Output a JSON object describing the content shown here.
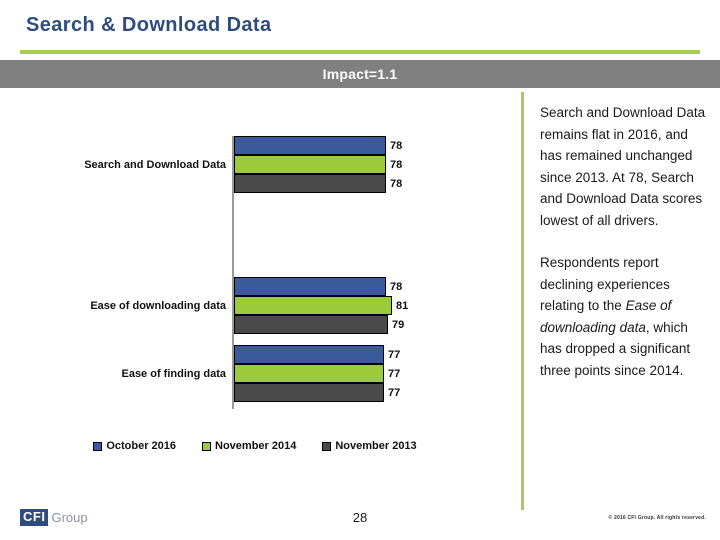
{
  "header": {
    "title": "Search & Download Data",
    "rule_color": "#A6CE53",
    "title_color": "#2E4C7E"
  },
  "impact_band": {
    "label": "Impact=1.1",
    "background": "#808080",
    "text_color": "#FFFFFF"
  },
  "chart_data": {
    "type": "bar",
    "orientation": "horizontal",
    "title": "",
    "xlabel": "",
    "ylabel": "",
    "categories": [
      "Search and Download Data",
      "Ease of downloading data",
      "Ease of finding data"
    ],
    "series": [
      {
        "name": "October 2016",
        "color": "#3B5A9B",
        "values": [
          78,
          78,
          77
        ]
      },
      {
        "name": "November 2014",
        "color": "#9BCB3B",
        "values": [
          78,
          81,
          77
        ]
      },
      {
        "name": "November 2013",
        "color": "#4A4A4A",
        "values": [
          78,
          79,
          77
        ]
      }
    ],
    "value_labels": [
      [
        "78",
        "78",
        "78"
      ],
      [
        "78",
        "81",
        "79"
      ],
      [
        "77",
        "77",
        "77"
      ]
    ],
    "xlim": [
      0,
      100
    ],
    "grid": false,
    "legend_position": "bottom",
    "legend": [
      "October 2016",
      "November 2014",
      "November 2013"
    ]
  },
  "commentary": {
    "paragraph_1": "Search and Download Data remains flat in 2016, and has remained unchanged since 2013. At 78, Search and Download Data scores lowest of all drivers.",
    "paragraph_2_before": "Respondents report declining experiences relating to the ",
    "paragraph_2_italic": "Ease of downloading data",
    "paragraph_2_after": ", which has dropped a significant three points since 2014."
  },
  "footer": {
    "logo_mark": "CFI",
    "logo_word": "Group",
    "page_number": "28",
    "copyright": "© 2016 CFI Group. All rights reserved."
  }
}
